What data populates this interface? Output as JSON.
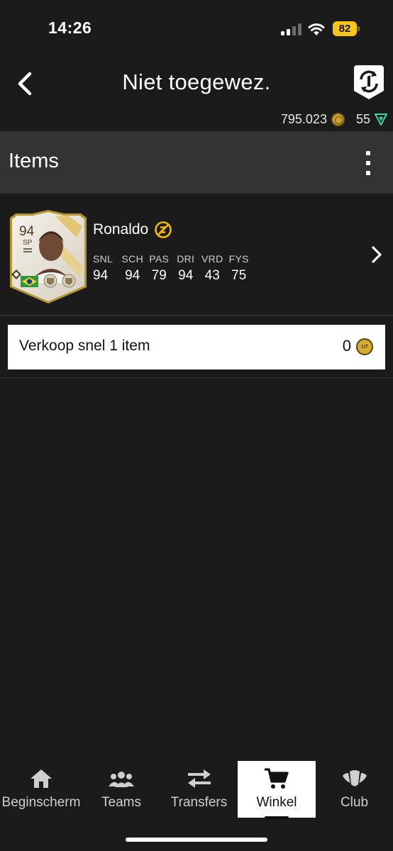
{
  "status_bar": {
    "time": "14:26",
    "battery": "82"
  },
  "header": {
    "title": "Niet toegewez.",
    "coins": "795.023",
    "points": "55"
  },
  "section": {
    "title": "Items"
  },
  "player": {
    "name": "Ronaldo",
    "rating": "94",
    "position": "SP",
    "stats": [
      {
        "label": "SNL",
        "value": "94"
      },
      {
        "label": "SCH",
        "value": "94"
      },
      {
        "label": "PAS",
        "value": "79"
      },
      {
        "label": "DRI",
        "value": "94"
      },
      {
        "label": "VRD",
        "value": "43"
      },
      {
        "label": "FYS",
        "value": "75"
      }
    ]
  },
  "quick_sell": {
    "label": "Verkoop snel 1 item",
    "value": "0",
    "coin_text": "UT"
  },
  "nav": {
    "items": [
      {
        "label": "Beginscherm",
        "icon": "home-icon"
      },
      {
        "label": "Teams",
        "icon": "teams-icon"
      },
      {
        "label": "Transfers",
        "icon": "transfers-icon"
      },
      {
        "label": "Winkel",
        "icon": "cart-icon",
        "active": true
      },
      {
        "label": "Club",
        "icon": "club-icon"
      }
    ]
  },
  "colors": {
    "background": "#1b1b1b",
    "section_header": "#333333",
    "accent_gold": "#f5c518",
    "points_green": "#3dd6a0"
  }
}
